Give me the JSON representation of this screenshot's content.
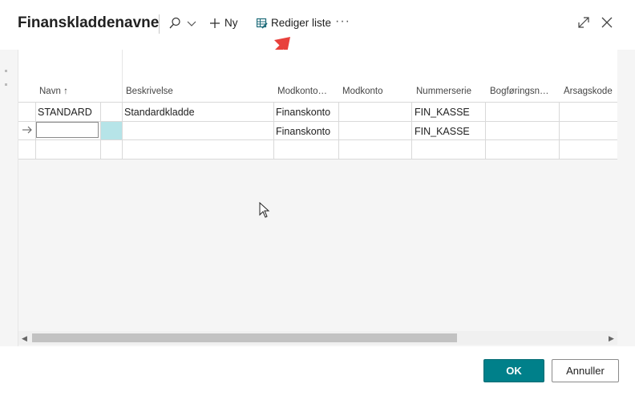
{
  "dialog": {
    "title": "Finanskladdenavne"
  },
  "toolbar": {
    "search_icon": "search-icon",
    "new_label": "Ny",
    "edit_list_label": "Rediger liste",
    "more_label": "···"
  },
  "table": {
    "headers": {
      "navn": "Navn",
      "sort_indicator": "↑",
      "beskrivelse": "Beskrivelse",
      "modkontotype": "Modkonto…",
      "modkonto": "Modkonto",
      "nummerserie": "Nummerserie",
      "bogforing": "Bogføringsn…",
      "arsagskode": "Årsagskode"
    },
    "rows": [
      {
        "navn": "STANDARD",
        "beskrivelse": "Standardkladde",
        "modkontotype": "Finanskonto",
        "modkonto": "",
        "nummerserie": "FIN_KASSE"
      },
      {
        "navn": "",
        "beskrivelse": "",
        "modkontotype": "Finanskonto",
        "modkonto": "",
        "nummerserie": "FIN_KASSE"
      }
    ]
  },
  "footer": {
    "ok_label": "OK",
    "cancel_label": "Annuller"
  },
  "colors": {
    "accent": "#00808a",
    "selected_cell": "#b6e4e8",
    "annotation_arrow": "#e8413c"
  }
}
